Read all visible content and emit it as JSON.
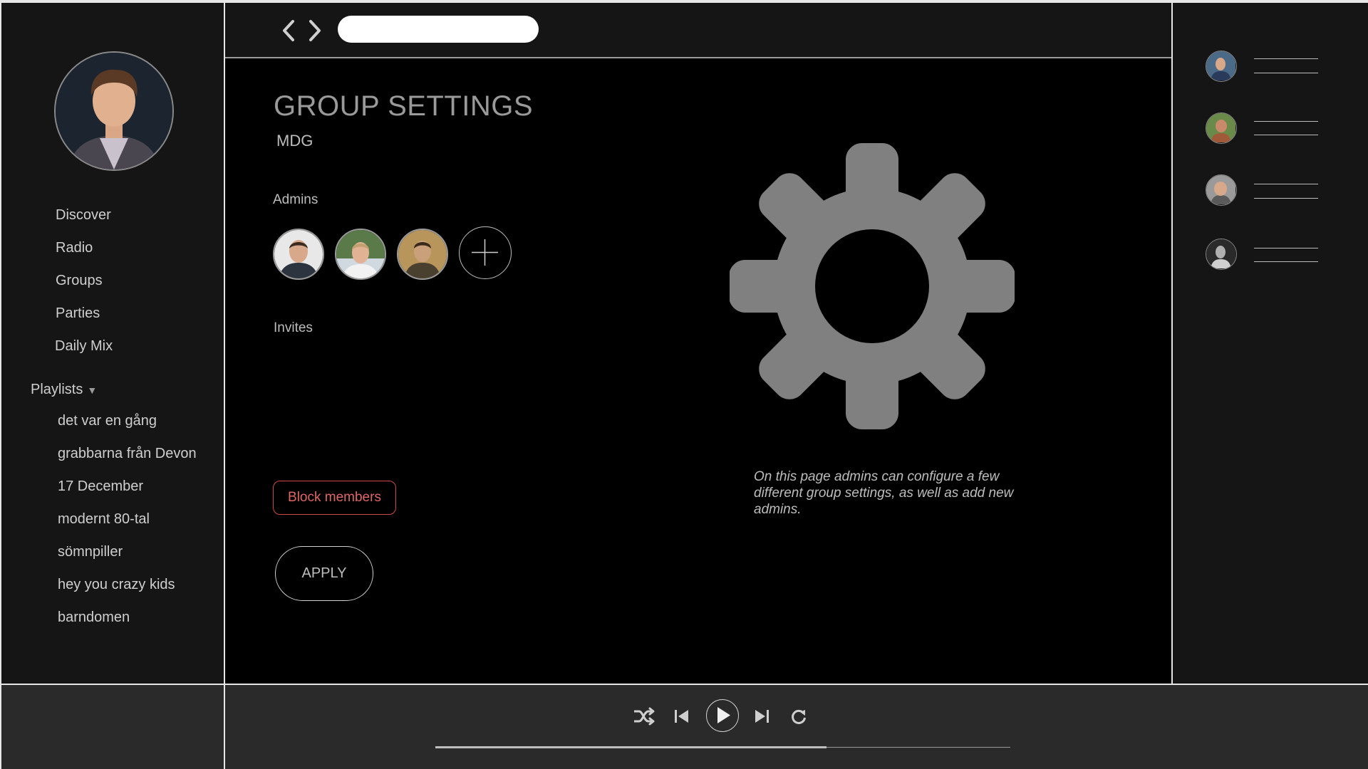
{
  "search": {
    "placeholder": ""
  },
  "sidebar": {
    "nav": [
      {
        "label": "Discover"
      },
      {
        "label": "Radio"
      },
      {
        "label": "Groups"
      },
      {
        "label": "Parties"
      },
      {
        "label": "Daily Mix"
      }
    ],
    "playlists_label": "Playlists",
    "playlists_caret": "▼",
    "playlists": [
      {
        "label": "det var en gång"
      },
      {
        "label": "grabbarna från Devon"
      },
      {
        "label": "17 December"
      },
      {
        "label": "modernt 80-tal"
      },
      {
        "label": "sömnpiller"
      },
      {
        "label": "hey you crazy kids"
      },
      {
        "label": "barndomen"
      }
    ]
  },
  "main": {
    "title": "GROUP SETTINGS",
    "group_name": "MDG",
    "admins_label": "Admins",
    "invites_label": "Invites",
    "block_members_label": "Block members",
    "apply_label": "APPLY",
    "info_text": "On this page admins can configure a few different group settings, as well as add new admins."
  },
  "player": {
    "progress": 0.68
  },
  "colors": {
    "accent_red": "#d04848",
    "gear": "#808080",
    "panel": "#151515",
    "player": "#2a2a2a"
  },
  "icons": [
    "back-chevron-icon",
    "forward-chevron-icon",
    "plus-icon",
    "gear-icon",
    "shuffle-icon",
    "previous-icon",
    "play-icon",
    "next-icon",
    "repeat-icon"
  ]
}
